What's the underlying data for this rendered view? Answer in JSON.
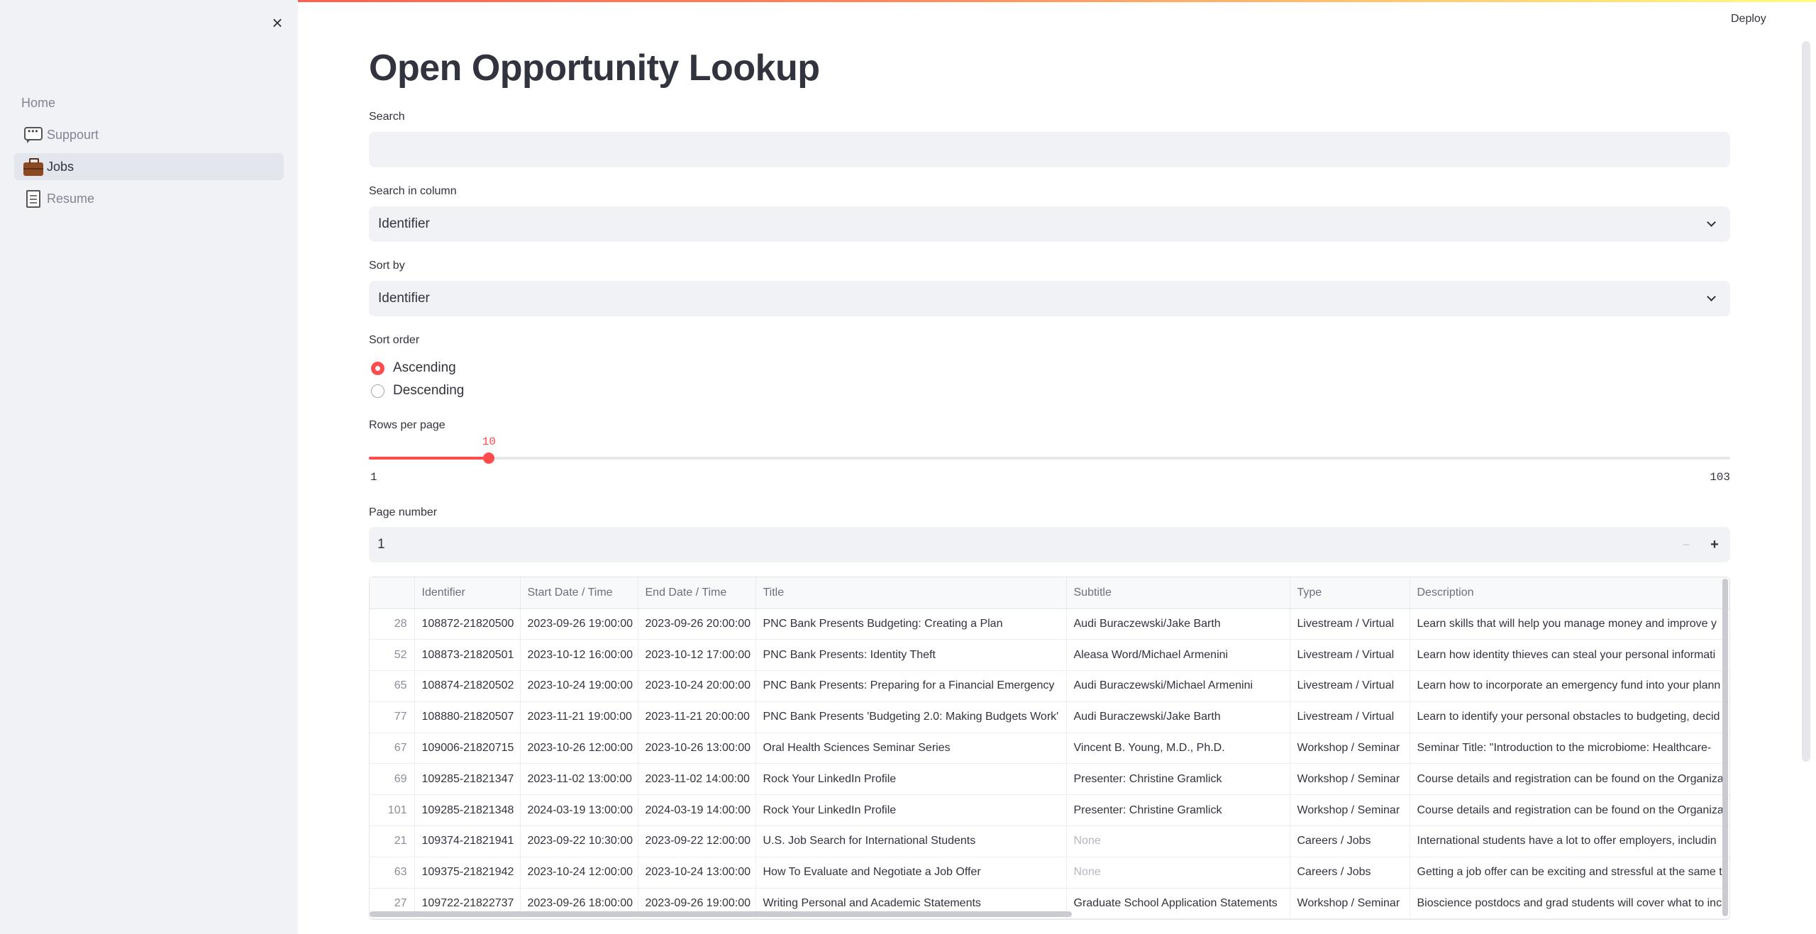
{
  "header": {
    "deploy_label": "Deploy"
  },
  "sidebar": {
    "close_label": "×",
    "items": [
      {
        "label": "Home",
        "icon": ""
      },
      {
        "label": "Suppourt",
        "icon": "speech-balloon-icon"
      },
      {
        "label": "Jobs",
        "icon": "briefcase-icon"
      },
      {
        "label": "Resume",
        "icon": "page-icon"
      }
    ]
  },
  "main": {
    "title": "Open Opportunity Lookup",
    "search": {
      "label": "Search",
      "value": "",
      "placeholder": ""
    },
    "search_column": {
      "label": "Search in column",
      "value": "Identifier"
    },
    "sort_by": {
      "label": "Sort by",
      "value": "Identifier"
    },
    "sort_order": {
      "label": "Sort order",
      "options": [
        "Ascending",
        "Descending"
      ],
      "selected": "Ascending"
    },
    "rows_per_page": {
      "label": "Rows per page",
      "value": "10",
      "min": "1",
      "max": "103"
    },
    "page_number": {
      "label": "Page number",
      "value": "1",
      "minus": "−",
      "plus": "+"
    },
    "table": {
      "columns": [
        "",
        "Identifier",
        "Start Date / Time",
        "End Date / Time",
        "Title",
        "Subtitle",
        "Type",
        "Description"
      ],
      "rows": [
        [
          "28",
          "108872-21820500",
          "2023-09-26 19:00:00",
          "2023-09-26 20:00:00",
          "PNC Bank Presents Budgeting: Creating a Plan",
          "Audi Buraczewski/Jake Barth",
          "Livestream / Virtual",
          "Learn skills that will help you manage money and improve y"
        ],
        [
          "52",
          "108873-21820501",
          "2023-10-12 16:00:00",
          "2023-10-12 17:00:00",
          "PNC Bank Presents: Identity Theft",
          "Aleasa Word/Michael Armenini",
          "Livestream / Virtual",
          "Learn how identity thieves can steal your personal informati"
        ],
        [
          "65",
          "108874-21820502",
          "2023-10-24 19:00:00",
          "2023-10-24 20:00:00",
          "PNC Bank Presents: Preparing for a Financial Emergency",
          "Audi Buraczewski/Michael Armenini",
          "Livestream / Virtual",
          "Learn how to incorporate an emergency fund into your plann"
        ],
        [
          "77",
          "108880-21820507",
          "2023-11-21 19:00:00",
          "2023-11-21 20:00:00",
          "PNC Bank Presents 'Budgeting 2.0: Making Budgets Work'",
          "Audi Buraczewski/Jake Barth",
          "Livestream / Virtual",
          "Learn to identify your personal obstacles to budgeting, decid"
        ],
        [
          "67",
          "109006-21820715",
          "2023-10-26 12:00:00",
          "2023-10-26 13:00:00",
          "Oral Health Sciences Seminar Series",
          "Vincent B. Young, M.D., Ph.D.",
          "Workshop / Seminar",
          "Seminar Title: \"Introduction to the microbiome: Healthcare-"
        ],
        [
          "69",
          "109285-21821347",
          "2023-11-02 13:00:00",
          "2023-11-02 14:00:00",
          "Rock Your LinkedIn Profile",
          "Presenter: Christine Gramlick",
          "Workshop / Seminar",
          "Course details and registration can be found on the Organiza"
        ],
        [
          "101",
          "109285-21821348",
          "2024-03-19 13:00:00",
          "2024-03-19 14:00:00",
          "Rock Your LinkedIn Profile",
          "Presenter: Christine Gramlick",
          "Workshop / Seminar",
          "Course details and registration can be found on the Organiza"
        ],
        [
          "21",
          "109374-21821941",
          "2023-09-22 10:30:00",
          "2023-09-22 12:00:00",
          "U.S. Job Search for International Students",
          "None",
          "Careers / Jobs",
          "International students have a lot to offer employers, includin"
        ],
        [
          "63",
          "109375-21821942",
          "2023-10-24 12:00:00",
          "2023-10-24 13:00:00",
          "How To Evaluate and Negotiate a Job Offer",
          "None",
          "Careers / Jobs",
          "Getting a job offer can be exciting and stressful at the same t"
        ],
        [
          "27",
          "109722-21822737",
          "2023-09-26 18:00:00",
          "2023-09-26 19:00:00",
          "Writing Personal and Academic Statements",
          "Graduate School Application Statements",
          "Workshop / Seminar",
          "Bioscience postdocs and grad students will cover what to inc"
        ]
      ]
    }
  },
  "colors": {
    "accent": "#ff4b4b",
    "sidebar_bg": "#f0f2f6",
    "text": "#31333f"
  }
}
